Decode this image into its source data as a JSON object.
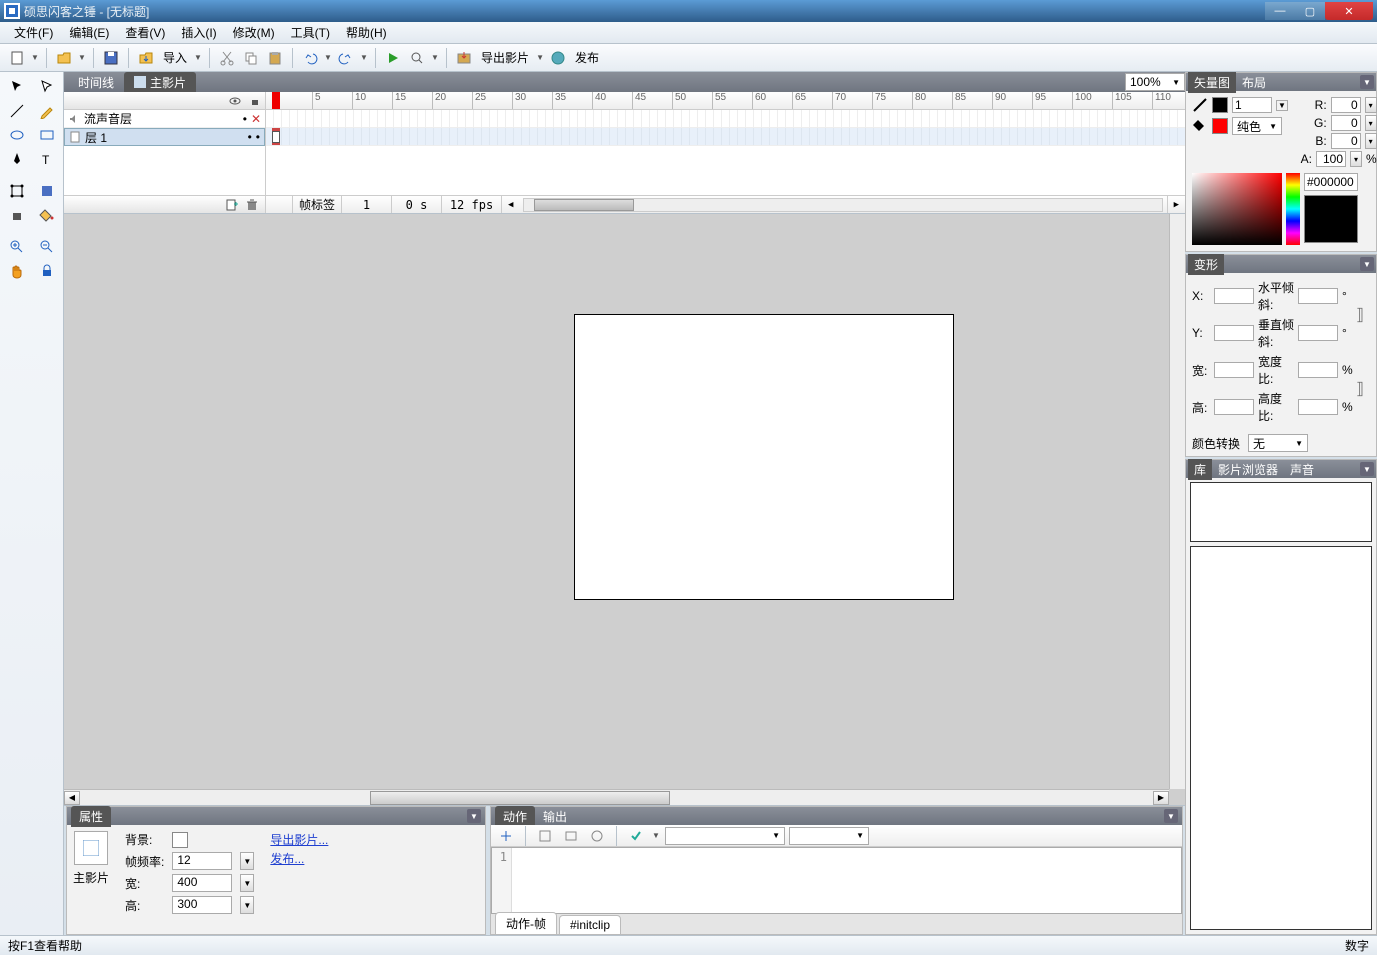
{
  "window": {
    "title": "硕思闪客之锤 - [无标题]"
  },
  "menu": {
    "file": "文件(F)",
    "edit": "编辑(E)",
    "view": "查看(V)",
    "insert": "插入(I)",
    "modify": "修改(M)",
    "tools": "工具(T)",
    "help": "帮助(H)"
  },
  "toolbar": {
    "import": "导入",
    "export": "导出影片",
    "publish": "发布"
  },
  "tabs": {
    "timeline": "时间线",
    "main_movie": "主影片"
  },
  "zoom": "100%",
  "timeline": {
    "layers": [
      "流声音层",
      "层 1"
    ],
    "frame_label": "帧标签",
    "current_frame": "1",
    "time": "0 s",
    "fps": "12 fps"
  },
  "props": {
    "panel": "属性",
    "label": "主影片",
    "bg": "背景:",
    "framerate": "帧频率:",
    "framerate_val": "12",
    "width": "宽:",
    "width_val": "400",
    "height": "高:",
    "height_val": "300",
    "export_link": "导出影片...",
    "publish_link": "发布..."
  },
  "actions": {
    "tab1": "动作",
    "tab2": "输出",
    "sub1": "动作-帧",
    "sub2": "#initclip",
    "line": "1"
  },
  "vector": {
    "tab1": "矢量图",
    "tab2": "布局",
    "stroke_w": "1",
    "fill_type": "纯色",
    "R": "R:",
    "G": "G:",
    "B": "B:",
    "A": "A:",
    "r": "0",
    "g": "0",
    "b": "0",
    "a": "100",
    "pct": "%",
    "hex": "#000000"
  },
  "transform": {
    "panel": "变形",
    "X": "X:",
    "Y": "Y:",
    "W": "宽:",
    "H": "高:",
    "hskew": "水平倾斜:",
    "vskew": "垂直倾斜:",
    "wratio": "宽度比:",
    "hratio": "高度比:",
    "deg": "°",
    "pct": "%",
    "color_xform": "颜色转换",
    "none": "无"
  },
  "library": {
    "tab1": "库",
    "tab2": "影片浏览器",
    "tab3": "声音"
  },
  "status": {
    "help": "按F1查看帮助",
    "numlock": "数字"
  }
}
